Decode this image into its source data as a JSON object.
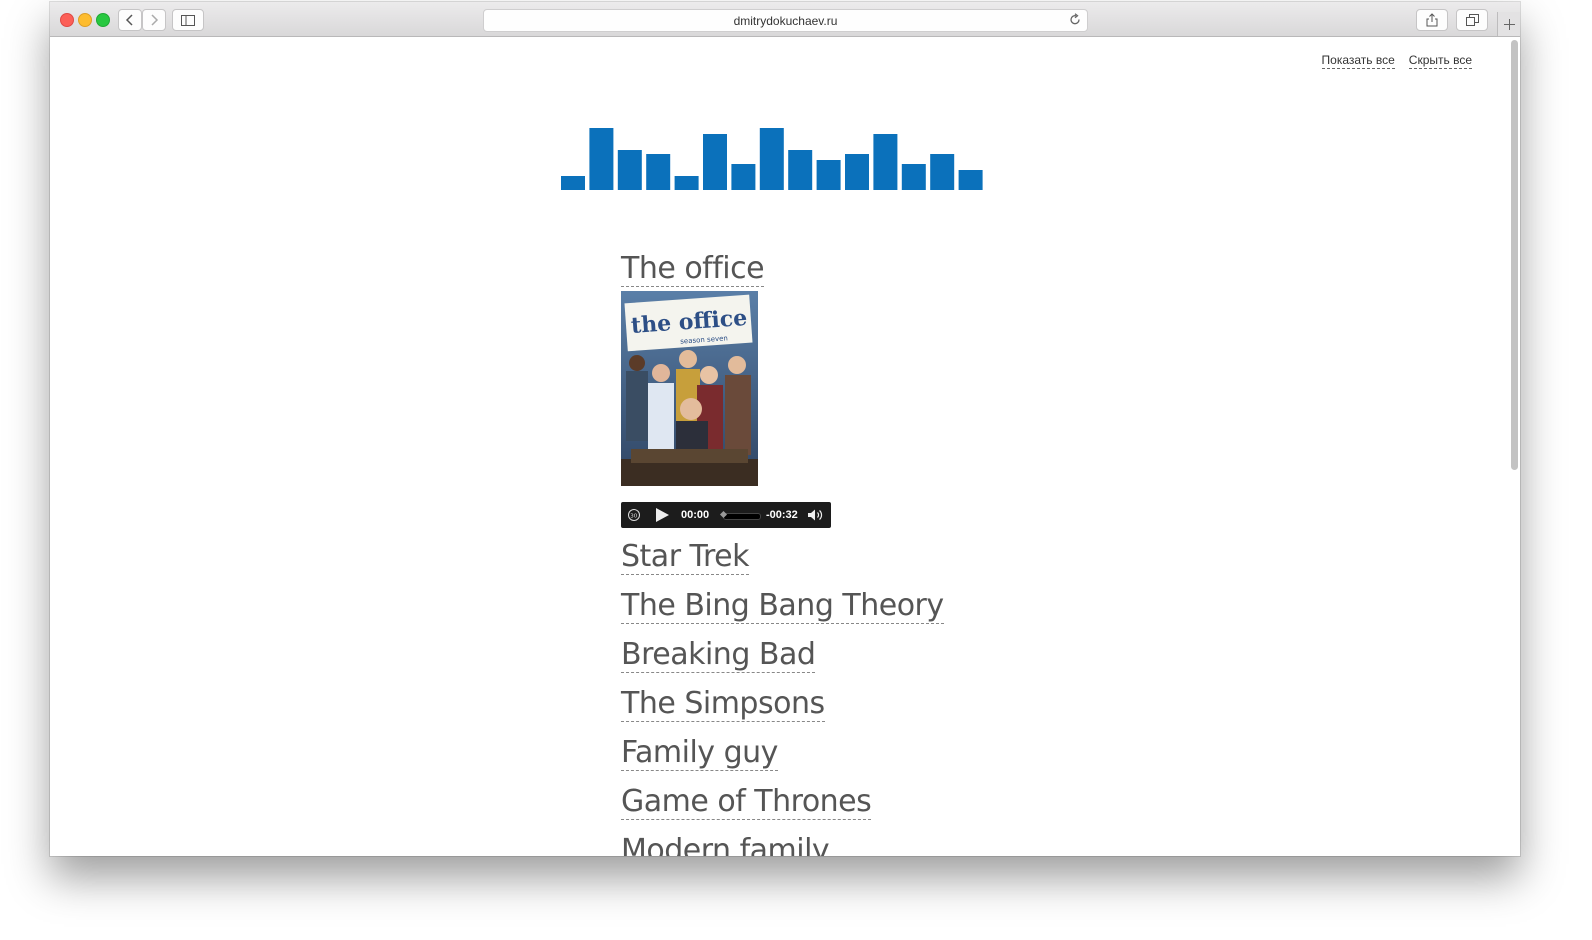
{
  "browser": {
    "url": "dmitrydokuchaev.ru"
  },
  "toplinks": {
    "show_all": "Показать все",
    "hide_all": "Скрыть все"
  },
  "logo": {
    "color": "#0b71bb"
  },
  "shows": [
    {
      "title": "The office",
      "expanded": true
    },
    {
      "title": "Star Trek"
    },
    {
      "title": "The Bing Bang Theory"
    },
    {
      "title": "Breaking Bad"
    },
    {
      "title": "The Simpsons"
    },
    {
      "title": "Family guy"
    },
    {
      "title": "Game of Thrones"
    },
    {
      "title": "Modern family"
    }
  ],
  "poster": {
    "title_text": "the office",
    "subtitle_text": "season seven"
  },
  "player": {
    "current_time": "00:00",
    "remaining_time": "-00:32",
    "progress": 0
  }
}
